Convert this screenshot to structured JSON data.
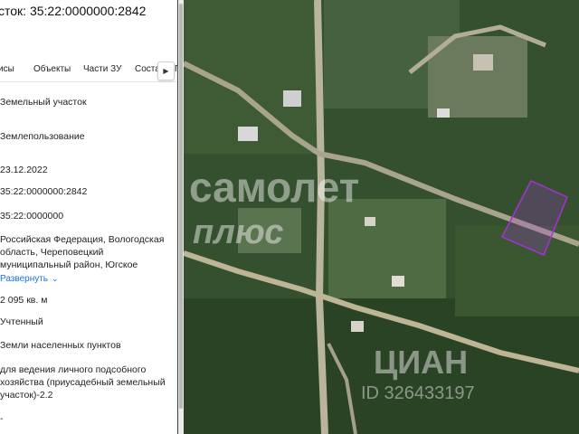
{
  "header": {
    "title": "сток: 35:22:0000000:2842"
  },
  "tabs": [
    {
      "label": "исы"
    },
    {
      "label": "Объекты"
    },
    {
      "label": "Части ЗУ"
    },
    {
      "label": "Соста"
    },
    {
      "label": "Г"
    }
  ],
  "tab_next_icon": "chevron-right-icon",
  "fields": {
    "type": "Земельный участок",
    "kind": "Землепользование",
    "date": "23.12.2022",
    "cad_number": "35:22:0000000:2842",
    "quarter": "35:22:0000000",
    "address_line1": "Российская Федерация, Вологодская",
    "address_line2": "область, Череповецкий",
    "address_line3": "муниципальный район, Югское",
    "expand_label": "Развернуть",
    "area": "2 095 кв. м",
    "status": "Учтенный",
    "category": "Земли населенных пунктов",
    "use_line1": "для ведения личного подсобного",
    "use_line2": "хозяйства (приусадебный земельный",
    "use_line3": "участок)-2.2",
    "dash": "-"
  },
  "map": {
    "watermark_brand_1": "самолет",
    "watermark_brand_2": "плюс",
    "watermark_cian": "ЦИАН",
    "watermark_id": "ID 326433197",
    "parcel_color": "#a433d6"
  }
}
